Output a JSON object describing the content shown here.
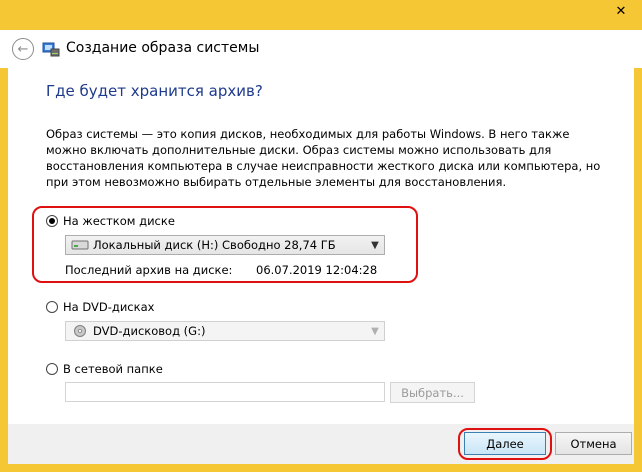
{
  "window": {
    "title": "Создание образа системы",
    "close_symbol": "✕"
  },
  "icons": {
    "back": "arrow-left-icon",
    "app": "system-image-icon",
    "hdd": "hard-drive-icon",
    "dvd": "dvd-drive-icon"
  },
  "main": {
    "heading": "Где будет хранится архив?",
    "description": "Образ системы — это копия дисков, необходимых для работы Windows. В него также можно включать дополнительные диски. Образ системы можно использовать для восстановления компьютера в случае неисправности жесткого диска или компьютера, но при этом невозможно выбирать отдельные элементы для восстановления."
  },
  "options": {
    "hard_disk": {
      "label": "На жестком диске",
      "selected": true,
      "drive_value": "Локальный диск (H:)  Свободно 28,74 ГБ",
      "last_backup_label": "Последний архив на диске:",
      "last_backup_value": "06.07.2019 12:04:28"
    },
    "dvd": {
      "label": "На DVD-дисках",
      "selected": false,
      "drive_value": "DVD-дисковод (G:)"
    },
    "network": {
      "label": "В сетевой папке",
      "selected": false,
      "path_value": "",
      "choose_label": "Выбрать..."
    }
  },
  "footer": {
    "next_label": "Далее",
    "cancel_label": "Отмена"
  },
  "colors": {
    "frame": "#f5c735",
    "heading": "#1e3a8c",
    "highlight": "#e01010"
  }
}
